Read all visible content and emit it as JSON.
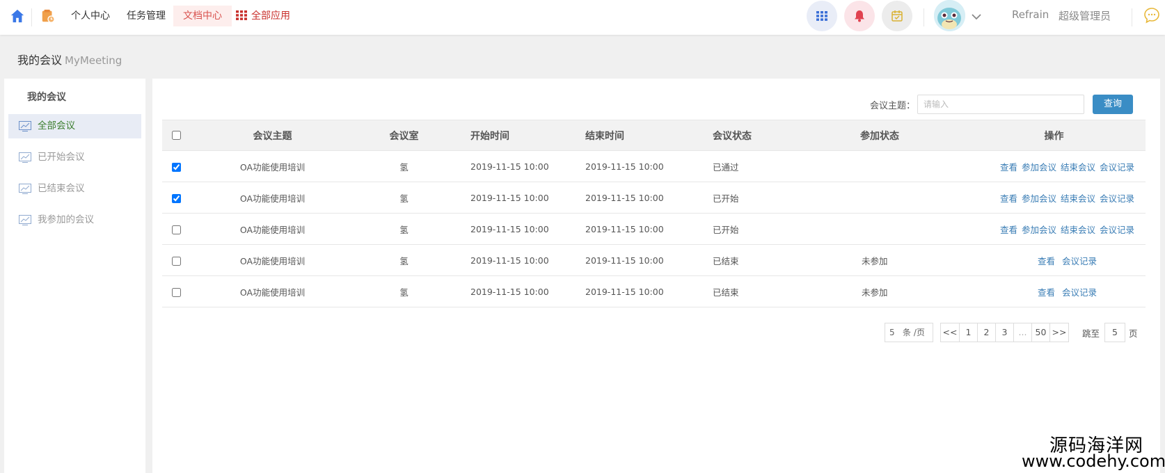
{
  "topbar": {
    "nav": [
      {
        "label": "个人中心"
      },
      {
        "label": "任务管理"
      },
      {
        "label": "文档中心"
      },
      {
        "label": "全部应用"
      }
    ],
    "user_name": "Refrain",
    "user_role": "超级管理员",
    "colors": {
      "apps": "#e9edf7",
      "bell": "#fbe4e8",
      "calendar": "#ececec"
    }
  },
  "page": {
    "title": "我的会议",
    "subtitle": "MyMeeting"
  },
  "sidebar": {
    "title": "我的会议",
    "items": [
      {
        "label": "全部会议",
        "active": true
      },
      {
        "label": "已开始会议",
        "active": false
      },
      {
        "label": "已结束会议",
        "active": false
      },
      {
        "label": "我参加的会议",
        "active": false
      }
    ]
  },
  "search": {
    "label": "会议主题：",
    "placeholder": "请输入",
    "button": "查询"
  },
  "table": {
    "headers": [
      "会议主题",
      "会议室",
      "开始时间",
      "结束时间",
      "会议状态",
      "参加状态",
      "操作"
    ],
    "rows": [
      {
        "checked": true,
        "topic": "OA功能使用培训",
        "room": "氢",
        "start": "2019-11-15 10:00",
        "end": "2019-11-15 10:00",
        "status": "已通过",
        "join": "",
        "ops": [
          "查看",
          "参加会议",
          "结束会议",
          "会议记录"
        ]
      },
      {
        "checked": true,
        "topic": "OA功能使用培训",
        "room": "氢",
        "start": "2019-11-15 10:00",
        "end": "2019-11-15 10:00",
        "status": "已开始",
        "join": "",
        "ops": [
          "查看",
          "参加会议",
          "结束会议",
          "会议记录"
        ]
      },
      {
        "checked": false,
        "topic": "OA功能使用培训",
        "room": "氢",
        "start": "2019-11-15 10:00",
        "end": "2019-11-15 10:00",
        "status": "已开始",
        "join": "",
        "ops": [
          "查看",
          "参加会议",
          "结束会议",
          "会议记录"
        ]
      },
      {
        "checked": false,
        "topic": "OA功能使用培训",
        "room": "氢",
        "start": "2019-11-15 10:00",
        "end": "2019-11-15 10:00",
        "status": "已结束",
        "join": "未参加",
        "ops": [
          "查看",
          "会议记录"
        ]
      },
      {
        "checked": false,
        "topic": "OA功能使用培训",
        "room": "氢",
        "start": "2019-11-15 10:00",
        "end": "2019-11-15 10:00",
        "status": "已结束",
        "join": "未参加",
        "ops": [
          "查看",
          "会议记录"
        ]
      }
    ]
  },
  "pagination": {
    "page_size": "5",
    "page_size_unit": "条 /页",
    "prev": "<<",
    "pages": [
      "1",
      "2",
      "3",
      "...",
      "50"
    ],
    "next": ">>",
    "jump_label": "跳至",
    "jump_value": "5",
    "jump_unit": "页"
  },
  "watermark": {
    "line1": "源码海洋网",
    "line2": "www.codehy.com"
  }
}
